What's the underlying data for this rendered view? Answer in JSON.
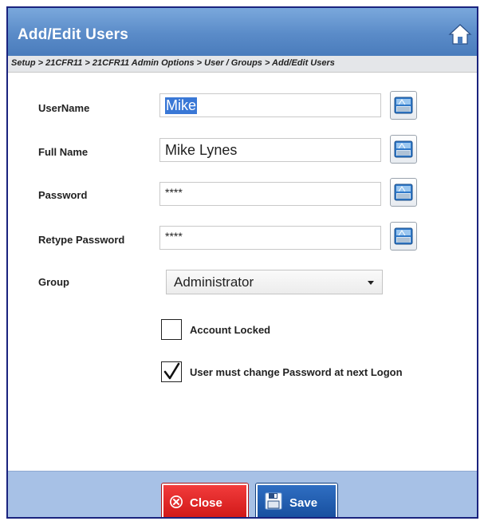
{
  "window": {
    "title": "Add/Edit Users",
    "breadcrumb": "Setup > 21CFR11 > 21CFR11 Admin Options > User / Groups > Add/Edit Users"
  },
  "form": {
    "username": {
      "label": "UserName",
      "value": "Mike"
    },
    "fullname": {
      "label": "Full Name",
      "value": "Mike Lynes"
    },
    "password": {
      "label": "Password",
      "value": "****"
    },
    "retype_password": {
      "label": "Retype Password",
      "value": "****"
    },
    "group": {
      "label": "Group",
      "selected": "Administrator"
    },
    "account_locked": {
      "label": "Account Locked",
      "checked": false
    },
    "must_change_password": {
      "label": "User must change Password at next Logon",
      "checked": true
    }
  },
  "footer": {
    "close_label": "Close",
    "save_label": "Save"
  },
  "icons": {
    "home": "home-icon",
    "keyboard": "keyboard-icon",
    "close": "close-circle-icon",
    "save": "floppy-disk-icon"
  },
  "colors": {
    "titlebar": "#5a8bc8",
    "footer": "#a7c1e6",
    "close_button": "#e02828",
    "save_button": "#1f5cae",
    "selection": "#3a78d6"
  }
}
